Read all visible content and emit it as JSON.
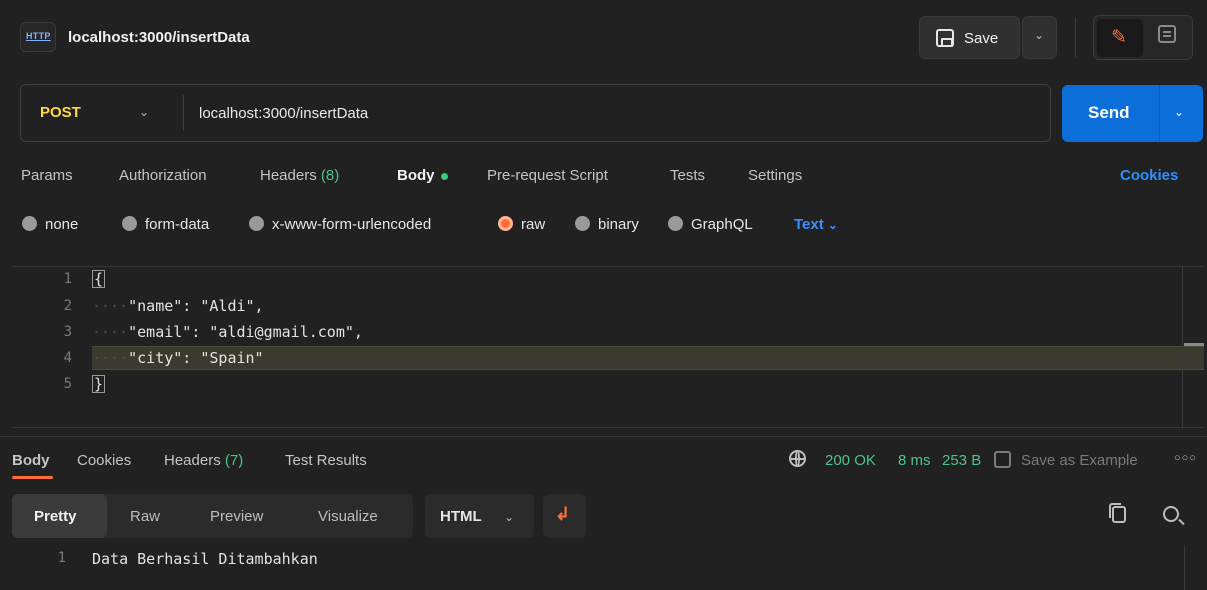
{
  "header": {
    "http_badge": "HTTP",
    "title": "localhost:3000/insertData",
    "save_label": "Save"
  },
  "request": {
    "method": "POST",
    "url": "localhost:3000/insertData",
    "send_label": "Send"
  },
  "req_tabs": {
    "params": "Params",
    "authorization": "Authorization",
    "headers_label": "Headers",
    "headers_count": "(8)",
    "body": "Body",
    "prerequest": "Pre-request Script",
    "tests": "Tests",
    "settings": "Settings",
    "cookies": "Cookies"
  },
  "body_types": {
    "none": "none",
    "form_data": "form-data",
    "urlencoded": "x-www-form-urlencoded",
    "raw": "raw",
    "binary": "binary",
    "graphql": "GraphQL",
    "text_type": "Text"
  },
  "editor": {
    "lines": [
      {
        "n": "1",
        "text": "{"
      },
      {
        "n": "2",
        "text": "\"name\": \"Aldi\","
      },
      {
        "n": "3",
        "text": "\"email\": \"aldi@gmail.com\","
      },
      {
        "n": "4",
        "text": "\"city\": \"Spain\""
      },
      {
        "n": "5",
        "text": "}"
      }
    ]
  },
  "response": {
    "tabs": {
      "body": "Body",
      "cookies": "Cookies",
      "headers_label": "Headers",
      "headers_count": "(7)",
      "test_results": "Test Results"
    },
    "status": "200 OK",
    "time": "8 ms",
    "size": "253 B",
    "save_as_example": "Save as Example",
    "view_tabs": {
      "pretty": "Pretty",
      "raw": "Raw",
      "preview": "Preview",
      "visualize": "Visualize"
    },
    "format": "HTML",
    "lines": [
      {
        "n": "1",
        "text": "Data Berhasil Ditambahkan"
      }
    ]
  },
  "colors": {
    "accent": "#ff6c37",
    "send_blue": "#0c6fd9",
    "method_yellow": "#ffd84a",
    "status_green": "#4cc38a",
    "link_blue": "#2e8fff"
  }
}
